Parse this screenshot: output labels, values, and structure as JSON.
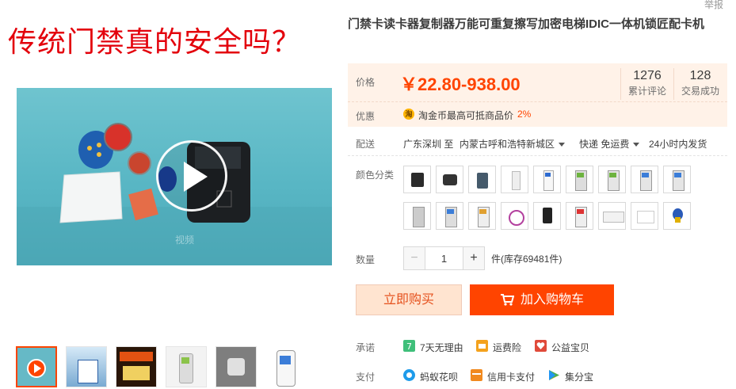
{
  "header": {
    "report_label": "举报"
  },
  "banner": {
    "title": "传统门禁真的安全吗？"
  },
  "product": {
    "title": "门禁卡读卡器复制器万能可重复擦写加密电梯IDIC一体机锁匠配卡机"
  },
  "price": {
    "label": "价格",
    "value": "￥22.80-938.00",
    "reviews_count": "1276",
    "reviews_label": "累计评论",
    "sales_count": "128",
    "sales_label": "交易成功"
  },
  "promo": {
    "label": "优惠",
    "coin_glyph": "淘",
    "text": "淘金币最高可抵商品价",
    "rate": "2%"
  },
  "shipping": {
    "label": "配送",
    "from": "广东深圳 至",
    "to": "内蒙古呼和浩特新城区",
    "method": "快递 免运费",
    "dispatch": "24小时内发货"
  },
  "color": {
    "label": "颜色分类"
  },
  "quantity": {
    "label": "数量",
    "value": "1",
    "minus": "−",
    "plus": "+",
    "stock": "件(库存69481件)"
  },
  "actions": {
    "buy_now": "立即购买",
    "add_to_cart": "加入购物车"
  },
  "promise": {
    "label": "承诺",
    "items": [
      "7天无理由",
      "运费险",
      "公益宝贝"
    ]
  },
  "payment": {
    "label": "支付",
    "items": [
      "蚂蚁花呗",
      "信用卡支付",
      "集分宝"
    ]
  },
  "video": {
    "watermark": "视频"
  },
  "colors": {
    "accent": "#ff4400",
    "price_bg": "#fff2e8",
    "banner_red": "#e3000b"
  }
}
